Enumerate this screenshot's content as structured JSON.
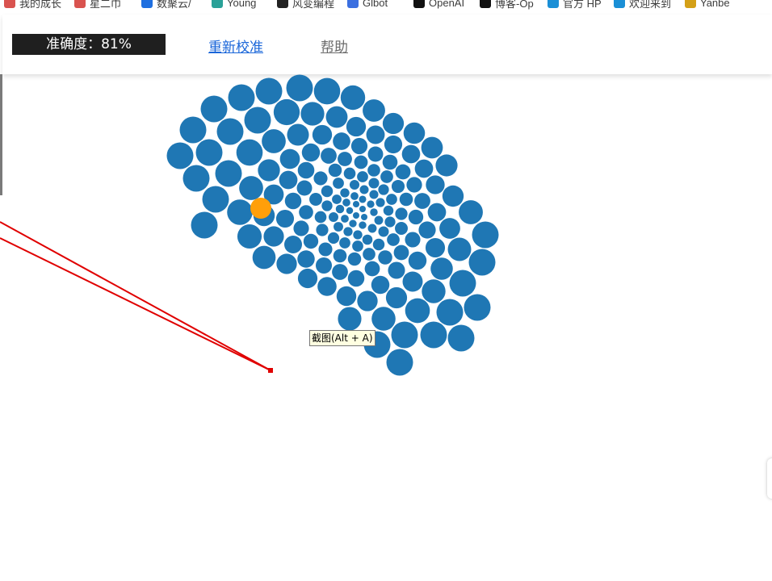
{
  "bookmarks": [
    {
      "label": "我的成长",
      "icon": "flag-icon",
      "color": "#d9534f"
    },
    {
      "label": "星二巾",
      "icon": "flag-icon",
      "color": "#d9534f"
    },
    {
      "label": "数聚云/",
      "icon": "cloud-icon",
      "color": "#1f6fe0"
    },
    {
      "label": "Young",
      "icon": "globe-icon",
      "color": "#2aa198"
    },
    {
      "label": "风变编程",
      "icon": "smile-icon",
      "color": "#222222"
    },
    {
      "label": "Glbot",
      "icon": "bot-icon",
      "color": "#3b6fe0"
    },
    {
      "label": "OpenAI",
      "icon": "openai-icon",
      "color": "#111111"
    },
    {
      "label": "博客-Op",
      "icon": "openai-icon",
      "color": "#111111"
    },
    {
      "label": "官方 HP",
      "icon": "hp-icon",
      "color": "#1a8fd6"
    },
    {
      "label": "欢迎来到",
      "icon": "hp-icon",
      "color": "#1a8fd6"
    },
    {
      "label": "Yanbe",
      "icon": "leaf-icon",
      "color": "#d4a017"
    }
  ],
  "header": {
    "accuracy_label": "准确度：81%",
    "recalibrate_label": "重新校准",
    "help_label": "帮助"
  },
  "tooltip": {
    "text": "截图(Alt + A)"
  },
  "colors": {
    "dot": "#1f77b4",
    "highlight": "#ff9f0a",
    "annotation_line": "#e00000"
  }
}
